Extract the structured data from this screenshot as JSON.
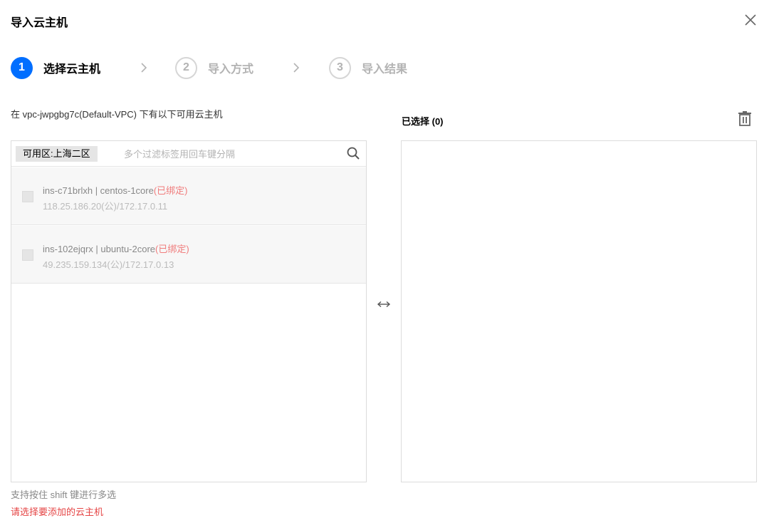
{
  "dialog": {
    "title": "导入云主机",
    "close_icon": "close-icon"
  },
  "steps": [
    {
      "number": "1",
      "label": "选择云主机",
      "state": "active"
    },
    {
      "number": "2",
      "label": "导入方式",
      "state": "todo"
    },
    {
      "number": "3",
      "label": "导入结果",
      "state": "todo"
    }
  ],
  "left": {
    "description": "在 vpc-jwpgbg7c(Default-VPC) 下有以下可用云主机",
    "zone_tag": "可用区:上海二区",
    "filter_placeholder": "多个过滤标签用回车键分隔",
    "filter_value": "",
    "items": [
      {
        "name_line": "ins-c71brlxh | centos-1core",
        "status": "(已绑定)",
        "ip_line": "118.25.186.20(公)/172.17.0.11",
        "checked": false,
        "disabled": true
      },
      {
        "name_line": "ins-102ejqrx | ubuntu-2core",
        "status": "(已绑定)",
        "ip_line": "49.235.159.134(公)/172.17.0.13",
        "checked": false,
        "disabled": true
      }
    ]
  },
  "right": {
    "title": "已选择 (0)",
    "clear_icon": "trash-icon"
  },
  "footer": {
    "hint": "支持按住 shift 键进行多选",
    "error": "请选择要添加的云主机"
  },
  "colors": {
    "accent": "#006eff",
    "error": "#e54545",
    "bound": "#f07c7c"
  }
}
